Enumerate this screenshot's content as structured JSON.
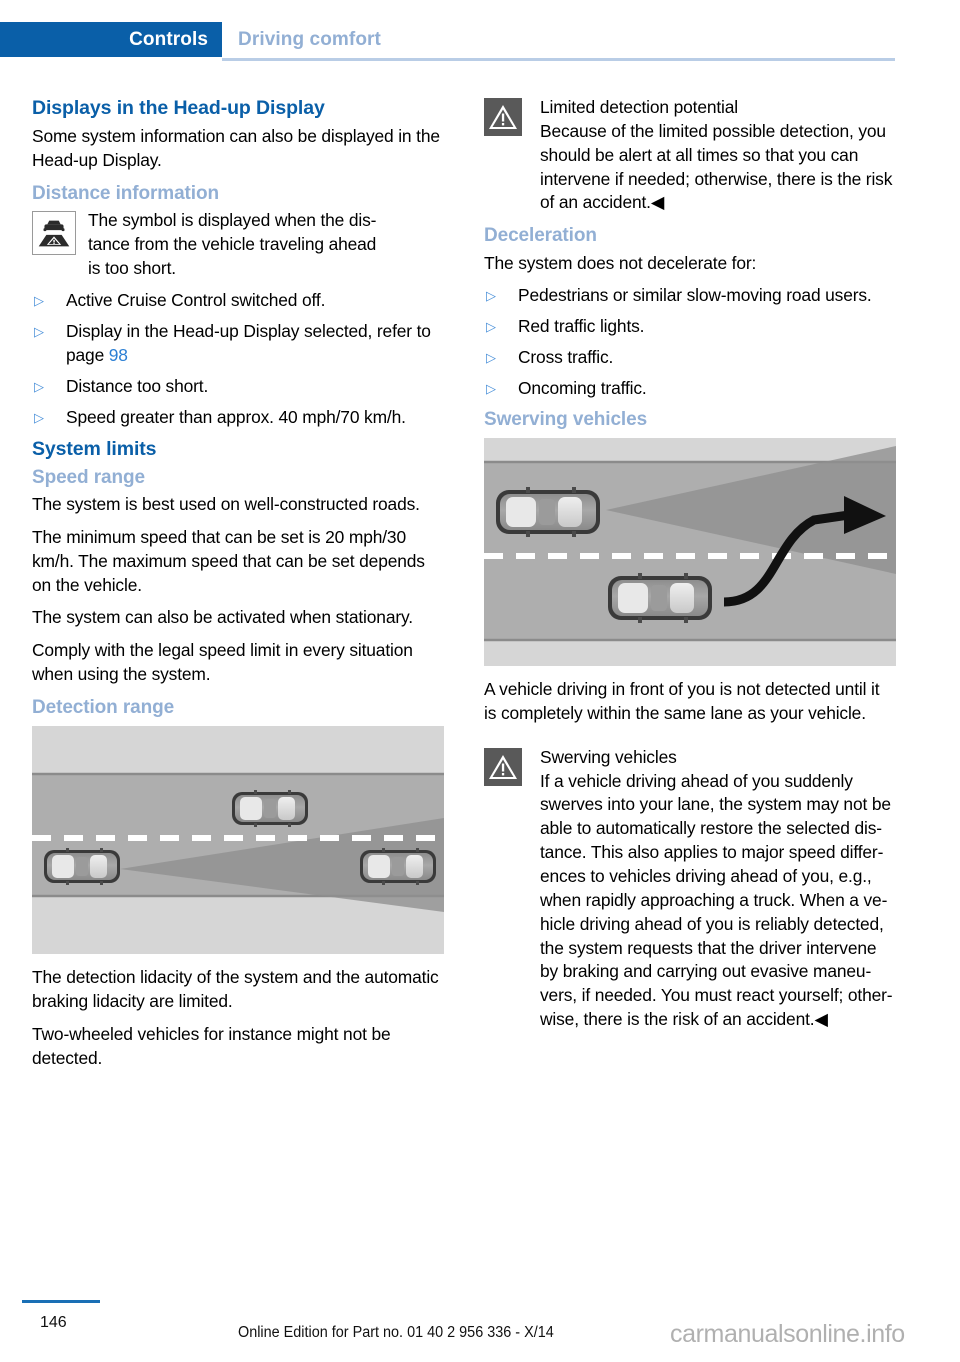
{
  "header": {
    "chapter": "Controls",
    "section": "Driving comfort"
  },
  "left_column": {
    "h2_headup": "Displays in the Head-up Display",
    "p_headup": "Some system information can also be dis­played in the Head-up Display.",
    "h3_distance": "Distance information",
    "distance_icon_name": "distance-warning-symbol",
    "distance_text_line1": "The symbol is displayed when the dis-",
    "distance_text_line2": "tance from the vehicle traveling ahead",
    "distance_text_line3": "is too short.",
    "bullets": [
      {
        "text": "Active Cruise Control switched off."
      },
      {
        "text": "Display in the Head-up Display selected, refer to page ",
        "xref": "98"
      },
      {
        "text": "Distance too short."
      },
      {
        "text": "Speed greater than approx. 40 mph/70 km/h."
      }
    ],
    "h2_system_limits": "System limits",
    "h3_speed_range": "Speed range",
    "p_speed_1": "The system is best used on well-constructed roads.",
    "p_speed_2": "The minimum speed that can be set is 20 mph/30 km/h. The maximum speed that can be set depends on the vehicle.",
    "p_speed_3": "The system can also be activated when sta­tionary.",
    "p_speed_4": "Comply with the legal speed limit in every sit­uation when using the system.",
    "h3_detection_range": "Detection range",
    "figure_detection_name": "detection-range-illustration",
    "p_detection_1": "The detection lidacity of the system and the automatic braking lidacity are limited.",
    "p_detection_2": "Two-wheeled vehicles for instance might not be detected."
  },
  "right_column": {
    "warning1_icon_name": "warning-triangle-icon",
    "warning1_title": "Limited detection potential",
    "warning1_body": "Because of the limited possible detec­tion, you should be alert at all times so that you can intervene if needed; otherwise, there is the risk of an accident.",
    "warning1_endmark": "◀",
    "h3_deceleration": "Deceleration",
    "p_deceleration": "The system does not decelerate for:",
    "bullets": [
      {
        "text": "Pedestrians or similar slow-moving road users."
      },
      {
        "text": "Red traffic lights."
      },
      {
        "text": "Cross traffic."
      },
      {
        "text": "Oncoming traffic."
      }
    ],
    "h3_swerving": "Swerving vehicles",
    "figure_swerving_name": "swerving-vehicles-illustration",
    "p_swerving": "A vehicle driving in front of you is not detected until it is completely within the same lane as your vehicle.",
    "warning2_icon_name": "warning-triangle-icon",
    "warning2_title": "Swerving vehicles",
    "warning2_body": "If a vehicle driving ahead of you suddenly swerves into your lane, the system may not be able to automatically restore the selected dis­tance. This also applies to major speed differ­ences to vehicles driving ahead of you, e.g., when rapidly approaching a truck. When a ve­hicle driving ahead of you is reliably detected, the system requests that the driver intervene by braking and carrying out evasive maneu­vers, if needed. You must react yourself; other­wise, there is the risk of an accident.",
    "warning2_endmark": "◀"
  },
  "footer": {
    "page_number": "146",
    "edition": "Online Edition for Part no. 01 40 2 956 336 - X/14",
    "watermark": "carmanualsonline.info"
  },
  "colors": {
    "tab_blue": "#0a5fa8",
    "heading_blue": "#0a5fa8",
    "subheading_blue": "#92afd4",
    "xref_blue": "#2b7fd4",
    "bullet_blue": "#4a90d9",
    "rule_blue": "#b9cde6"
  }
}
